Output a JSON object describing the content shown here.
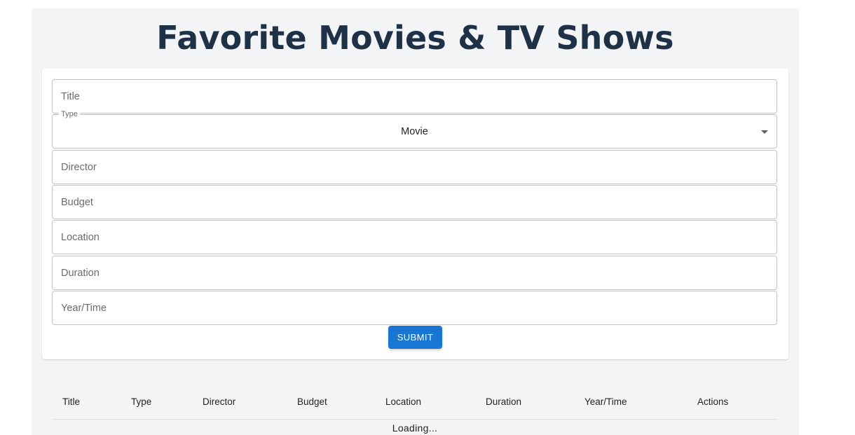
{
  "page": {
    "title": "Favorite Movies & TV Shows",
    "accent_color": "#1976d2",
    "title_color": "#1f3146"
  },
  "form": {
    "title_placeholder": "Title",
    "type_label": "Type",
    "type_value": "Movie",
    "director_placeholder": "Director",
    "budget_placeholder": "Budget",
    "location_placeholder": "Location",
    "duration_placeholder": "Duration",
    "year_placeholder": "Year/Time",
    "submit_label": "SUBMIT"
  },
  "table": {
    "columns": [
      "Title",
      "Type",
      "Director",
      "Budget",
      "Location",
      "Duration",
      "Year/Time",
      "Actions"
    ],
    "status": "Loading..."
  },
  "icons": {
    "select_caret": "arrow-drop-down-icon"
  }
}
